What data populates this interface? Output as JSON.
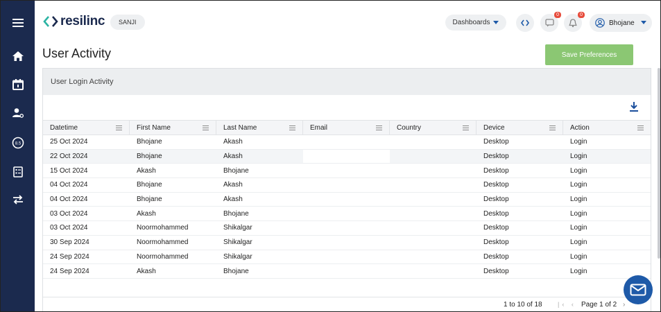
{
  "nav": {
    "items": [
      {
        "icon": "menu-icon"
      },
      {
        "icon": "home-icon"
      },
      {
        "icon": "calendar-icon"
      },
      {
        "icon": "user-settings-icon"
      },
      {
        "icon": "score-icon",
        "label": "8.5"
      },
      {
        "icon": "checklist-icon"
      },
      {
        "icon": "transfer-icon"
      }
    ]
  },
  "header": {
    "logo_text": "resilinc",
    "tenant": "SANJI",
    "dashboards_label": "Dashboards",
    "code_icon": "code-icon",
    "messages_badge": "0",
    "notifications_badge": "0",
    "user_name": "Bhojane"
  },
  "page": {
    "title": "User Activity",
    "save_label": "Save Preferences"
  },
  "card": {
    "title": "User Login Activity"
  },
  "table": {
    "columns": [
      "Datetime",
      "First Name",
      "Last Name",
      "Email",
      "Country",
      "Device",
      "Action"
    ],
    "rows": [
      [
        "25 Oct 2024",
        "Bhojane",
        "Akash",
        "",
        "",
        "Desktop",
        "Login"
      ],
      [
        "22 Oct 2024",
        "Bhojane",
        "Akash",
        "",
        "",
        "Desktop",
        "Login"
      ],
      [
        "15 Oct 2024",
        "Akash",
        "Bhojane",
        "",
        "",
        "Desktop",
        "Login"
      ],
      [
        "04 Oct 2024",
        "Bhojane",
        "Akash",
        "",
        "",
        "Desktop",
        "Login"
      ],
      [
        "04 Oct 2024",
        "Bhojane",
        "Akash",
        "",
        "",
        "Desktop",
        "Login"
      ],
      [
        "03 Oct 2024",
        "Akash",
        "Bhojane",
        "",
        "",
        "Desktop",
        "Login"
      ],
      [
        "03 Oct 2024",
        "Noormohammed",
        "Shikalgar",
        "",
        "",
        "Desktop",
        "Login"
      ],
      [
        "30 Sep 2024",
        "Noormohammed",
        "Shikalgar",
        "",
        "",
        "Desktop",
        "Login"
      ],
      [
        "24 Sep 2024",
        "Noormohammed",
        "Shikalgar",
        "",
        "",
        "Desktop",
        "Login"
      ],
      [
        "24 Sep 2024",
        "Akash",
        "Bhojane",
        "",
        "",
        "Desktop",
        "Login"
      ]
    ]
  },
  "pagination": {
    "count_text": "1 to 10 of 18",
    "page_text": "Page 1 of 2"
  },
  "colors": {
    "nav_bg": "#1b2a4e",
    "accent_green": "#8bc773",
    "logo_teal": "#2bb3a3",
    "badge_red": "#e74c3c",
    "chat_blue": "#1e5aa8"
  }
}
